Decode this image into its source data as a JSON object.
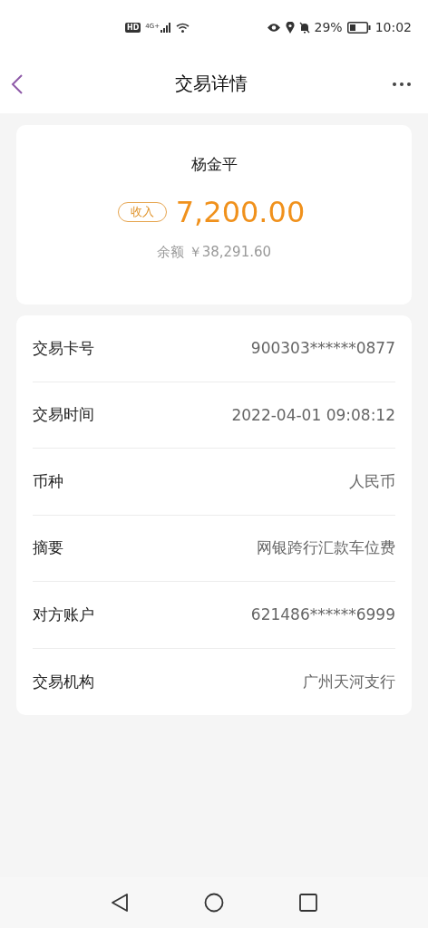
{
  "status_bar": {
    "hd": "HD",
    "network": "4G+",
    "battery_percent": "29%",
    "time": "10:02"
  },
  "header": {
    "title": "交易详情"
  },
  "summary": {
    "name": "杨金平",
    "tag": "收入",
    "amount": "7,200.00",
    "balance": "余额 ￥38,291.60"
  },
  "details": [
    {
      "label": "交易卡号",
      "value": "900303******0877"
    },
    {
      "label": "交易时间",
      "value": "2022-04-01 09:08:12"
    },
    {
      "label": "币种",
      "value": "人民币"
    },
    {
      "label": "摘要",
      "value": "网银跨行汇款车位费"
    },
    {
      "label": "对方账户",
      "value": "621486******6999"
    },
    {
      "label": "交易机构",
      "value": "广州天河支行"
    }
  ]
}
